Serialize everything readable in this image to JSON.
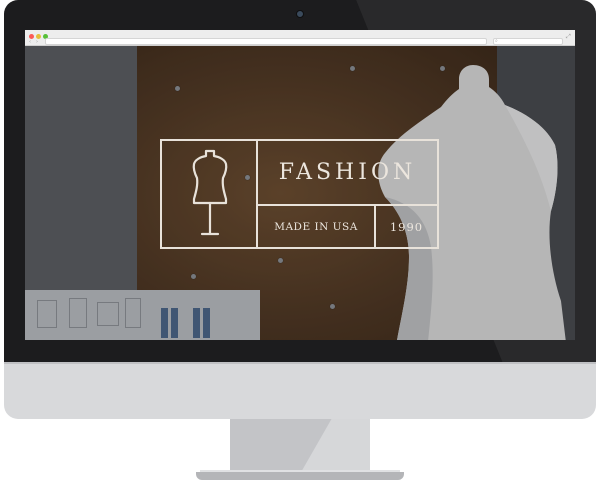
{
  "browser": {
    "window_controls": [
      "close",
      "minimize",
      "maximize"
    ],
    "address_value": "",
    "search_value": ""
  },
  "hero": {
    "background": "photo of a white dress form in front of a cork board with fashion sketches",
    "icon": "dress-form-icon"
  },
  "logo": {
    "name": "FASHION",
    "tagline": "MADE IN USA",
    "year": "1990"
  },
  "colors": {
    "bezel": "#1c1c1e",
    "chin": "#d8d9db",
    "logo_line": "#e8e2da",
    "cork": "#5b4027"
  }
}
